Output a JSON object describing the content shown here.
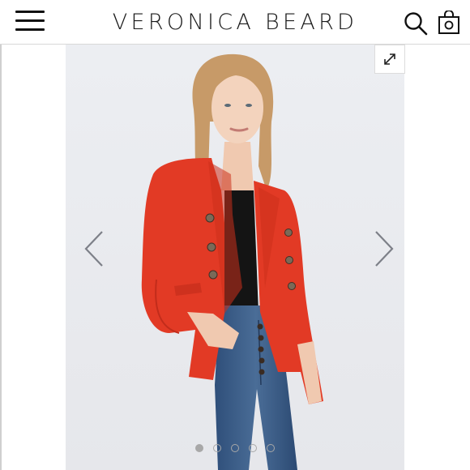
{
  "header": {
    "brand": "VERONICA BEARD",
    "icons": {
      "menu": "hamburger-menu-icon",
      "search": "search-icon",
      "bag": "shopping-bag-icon"
    }
  },
  "gallery": {
    "icons": {
      "expand": "expand-icon",
      "previous": "chevron-left-icon",
      "next": "chevron-right-icon"
    },
    "slide_count": 5,
    "active_slide": 1
  },
  "colors": {
    "blazer": "#e23a25",
    "denim": "#3c5f8b",
    "background": "#ecedf1",
    "text": "#1a1a1a"
  }
}
